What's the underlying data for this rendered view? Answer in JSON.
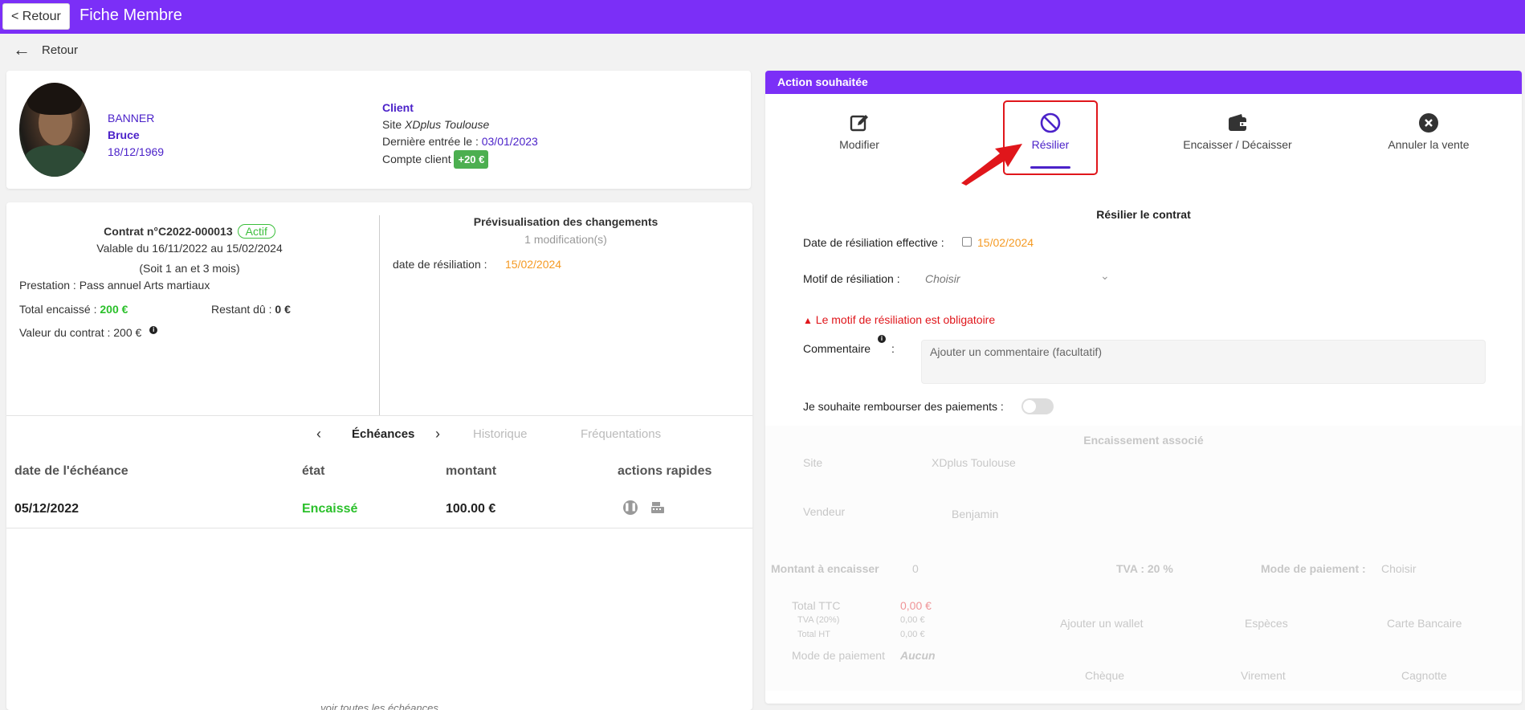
{
  "header": {
    "back_label": "< Retour",
    "title": "Fiche Membre"
  },
  "back_link": {
    "label": "Retour"
  },
  "member": {
    "lastname": "BANNER",
    "firstname": "Bruce",
    "birthdate": "18/12/1969",
    "client_label": "Client",
    "site_prefix": "Site ",
    "site_name": "XDplus Toulouse",
    "last_entry_label": "Dernière entrée le : ",
    "last_entry_date": "03/01/2023",
    "account_label": "Compte client ",
    "account_balance": "+20 €"
  },
  "contract": {
    "number": "Contrat n°C2022-000013",
    "status": "Actif",
    "validity": "Valable du 16/11/2022 au 15/02/2024",
    "duration": "(Soit 1 an et 3 mois)",
    "prestation_label": "Prestation : ",
    "prestation_value": "Pass annuel Arts martiaux",
    "total_label": "Total encaissé : ",
    "total_value": "200 €",
    "remaining_label": "Restant dû : ",
    "remaining_value": "0 €",
    "value_label": "Valeur du contrat : ",
    "value_value": "200 €"
  },
  "preview": {
    "title": "Prévisualisation des changements",
    "count": "1 modification(s)",
    "field_label": "date de résiliation :",
    "field_value": "15/02/2024"
  },
  "tabs": {
    "active": "Échéances",
    "history": "Historique",
    "attendance": "Fréquentations"
  },
  "table": {
    "headers": [
      "date de l'échéance",
      "état",
      "montant",
      "actions rapides"
    ],
    "rows": [
      {
        "date": "05/12/2022",
        "status": "Encaissé",
        "amount": "100.00 €"
      }
    ],
    "footer_link": "voir toutes les échéances"
  },
  "actions": {
    "header": "Action souhaitée",
    "buttons": [
      "Modifier",
      "Résilier",
      "Encaisser / Décaisser",
      "Annuler la vente"
    ]
  },
  "resiliation": {
    "title": "Résilier le contrat",
    "date_label": "Date de résiliation effective :",
    "date_value": "15/02/2024",
    "reason_label": "Motif de résiliation :",
    "reason_placeholder": "Choisir",
    "error": "Le motif de résiliation est obligatoire",
    "comment_label": "Commentaire",
    "comment_colon": ":",
    "comment_placeholder": "Ajouter un commentaire (facultatif)",
    "refund_label": "Je souhaite rembourser des paiements :"
  },
  "encaissement": {
    "title": "Encaissement associé",
    "site_label": "Site",
    "site_value": "XDplus Toulouse",
    "seller_label": "Vendeur",
    "seller_value": "Benjamin",
    "amount_label": "Montant à encaisser",
    "amount_value": "0",
    "tva_label": "TVA : 20 %",
    "payment_mode_label": "Mode de paiement :",
    "payment_mode_placeholder": "Choisir",
    "total_ttc_label": "Total TTC",
    "total_ttc_value": "0,00 €",
    "tva_line_label": "TVA (20%)",
    "tva_line_value": "0,00 €",
    "total_ht_label": "Total HT",
    "total_ht_value": "0,00 €",
    "mode_label": "Mode de paiement",
    "mode_value": "Aucun",
    "methods": [
      "Ajouter un wallet",
      "Espèces",
      "Carte Bancaire",
      "Chèque",
      "Virement",
      "Cagnotte"
    ]
  },
  "colors": {
    "brand": "#7b2ff7",
    "accent": "#4b22c9",
    "success": "#2bc02b",
    "warning": "#f59a23",
    "error": "#e0161b"
  }
}
